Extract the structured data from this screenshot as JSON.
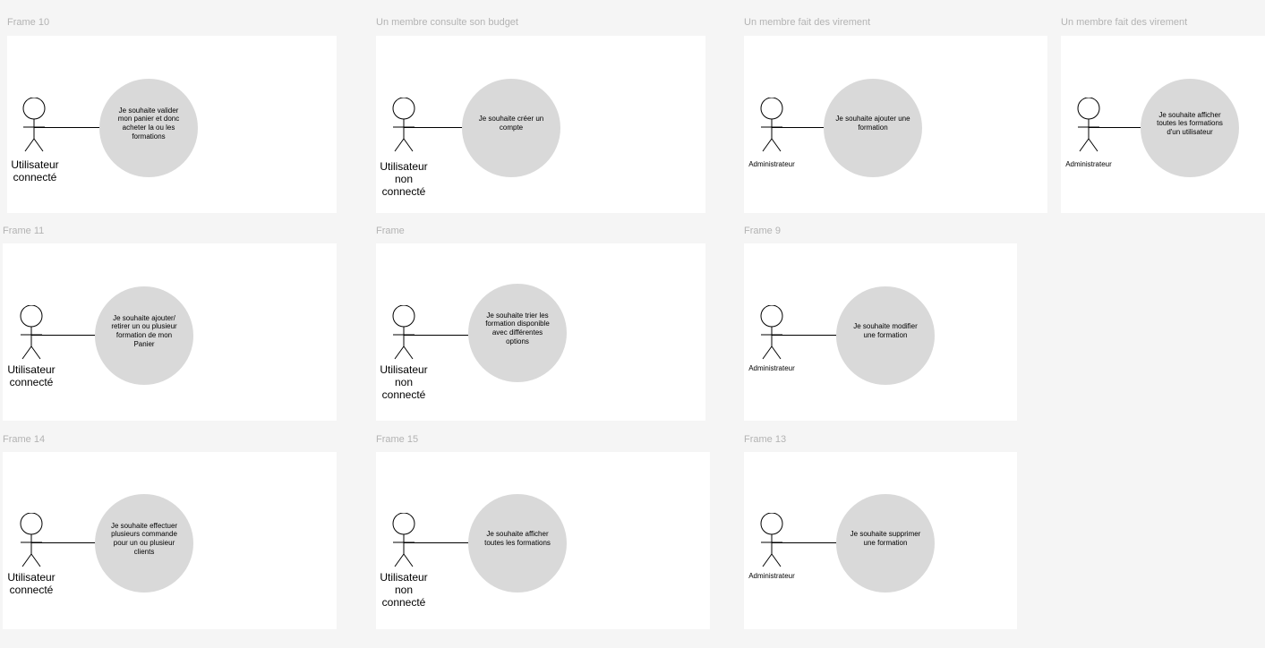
{
  "frames": [
    {
      "title": "Frame 10",
      "actor": "Utilisateur\nconnecté",
      "use_case": "Je souhaite valider mon panier et donc acheter la ou les formations"
    },
    {
      "title": "Un membre consulte son budget",
      "actor": "Utilisateur\nnon\nconnecté",
      "use_case": "Je souhaite créer un compte"
    },
    {
      "title": "Un membre fait des virement",
      "actor": "Administrateur",
      "use_case": "Je souhaite ajouter une formation"
    },
    {
      "title": "Un membre fait des virement",
      "actor": "Administrateur",
      "use_case": "Je souhaite afficher toutes les formations d'un utilisateur"
    },
    {
      "title": "Frame 11",
      "actor": "Utilisateur\nconnecté",
      "use_case": "Je souhaite ajouter/ retirer un ou plusieur formation de mon Panier"
    },
    {
      "title": "Frame",
      "actor": "Utilisateur\nnon\nconnecté",
      "use_case": "Je souhaite trier les formation disponible avec différentes options"
    },
    {
      "title": "Frame 9",
      "actor": "Administrateur",
      "use_case": "Je souhaite modifier une formation"
    },
    {
      "title": "Frame 14",
      "actor": "Utilisateur\nconnecté",
      "use_case": "Je souhaite effectuer plusieurs commande pour un ou plusieur clients"
    },
    {
      "title": "Frame 15",
      "actor": "Utilisateur\nnon\nconnecté",
      "use_case": "Je souhaite afficher toutes les formations"
    },
    {
      "title": "Frame 13",
      "actor": "Administrateur",
      "use_case": "Je souhaite supprimer une formation"
    }
  ]
}
